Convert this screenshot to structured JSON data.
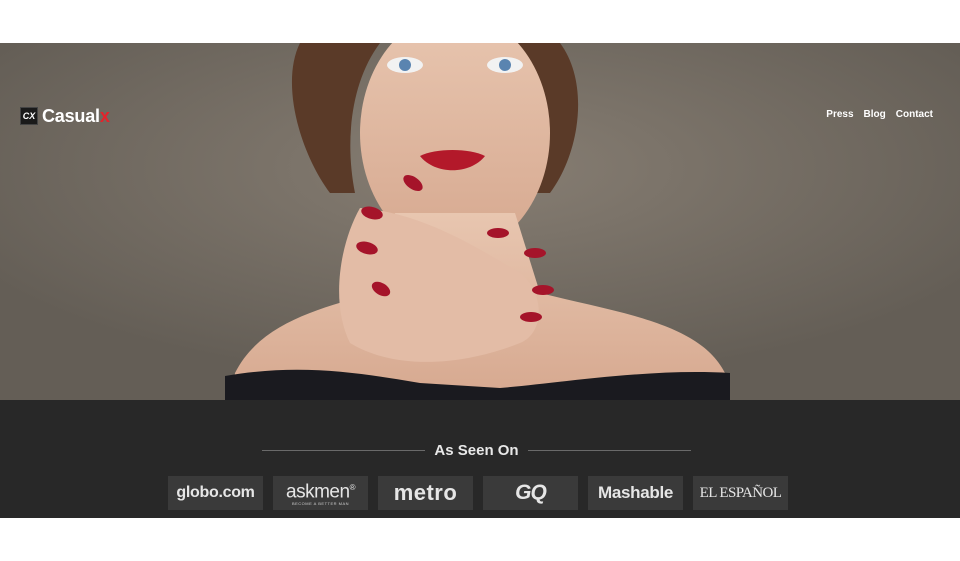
{
  "header": {
    "logo_mark": "CX",
    "logo_text": "Casual",
    "logo_x": "x",
    "nav": [
      {
        "label": "Press"
      },
      {
        "label": "Blog"
      },
      {
        "label": "Contact"
      }
    ]
  },
  "hero": {
    "image": "woman-portrait-red-nails"
  },
  "seen_on": {
    "title": "As Seen On",
    "logos": [
      {
        "name": "globo.com"
      },
      {
        "name": "askmen",
        "tagline": "BECOME A BETTER MAN",
        "mark": "®"
      },
      {
        "name": "metro"
      },
      {
        "name": "GQ"
      },
      {
        "name": "Mashable"
      },
      {
        "name": "EL ESPAÑOL"
      }
    ]
  },
  "colors": {
    "brand_red": "#e3232c",
    "hero_bg": "#726b62",
    "band_bg": "#282828",
    "badge_bg": "#3a3a3a"
  }
}
